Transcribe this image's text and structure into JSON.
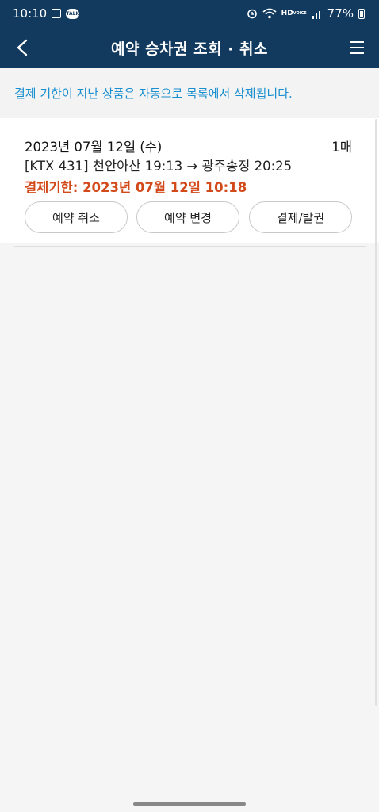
{
  "status_bar": {
    "time": "10:10",
    "battery": "77%"
  },
  "header": {
    "title": "예약 승차권 조회 · 취소"
  },
  "notice": "결제 기한이 지난 상품은 자동으로 목록에서 삭제됩니다.",
  "reservation": {
    "date": "2023년 07월 12일 (수)",
    "count": "1매",
    "route": "[KTX 431] 천안아산 19:13 → 광주송정 20:25",
    "deadline": "결제기한: 2023년 07월 12일 10:18"
  },
  "buttons": {
    "cancel": "예약 취소",
    "change": "예약 변경",
    "pay": "결제/발권"
  },
  "colors": {
    "header_bg": "#123a5e",
    "notice_text": "#1a8fd0",
    "deadline_text": "#d2491a"
  }
}
